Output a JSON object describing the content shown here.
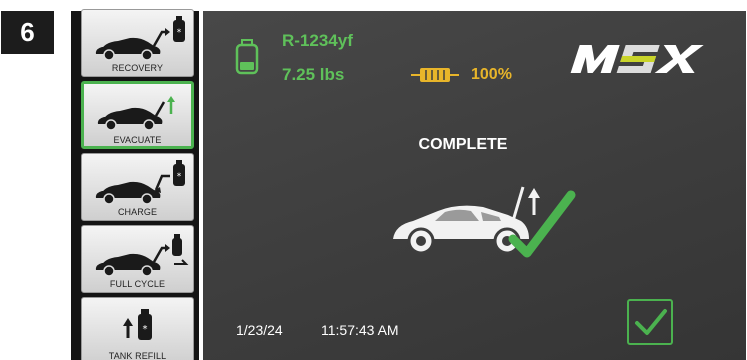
{
  "step": {
    "number": "6"
  },
  "sidebar": {
    "items": [
      {
        "label": "RECOVERY",
        "icon": "car-recovery-icon",
        "active": false
      },
      {
        "label": "EVACUATE",
        "icon": "car-evacuate-icon",
        "active": true
      },
      {
        "label": "CHARGE",
        "icon": "car-charge-icon",
        "active": false
      },
      {
        "label": "FULL CYCLE",
        "icon": "car-full-cycle-icon",
        "active": false
      },
      {
        "label": "TANK REFILL",
        "icon": "tank-refill-icon",
        "active": false
      }
    ]
  },
  "header": {
    "refrigerant": "R-1234yf",
    "weight": "7.25 lbs",
    "battery": "100%",
    "logo_text": "MSX"
  },
  "main": {
    "status": "COMPLETE",
    "hero_icon": "car-complete-icon"
  },
  "footer": {
    "date": "1/23/24",
    "time": "11:57:43 AM",
    "confirm_icon": "checkmark-icon"
  },
  "colors": {
    "accent_green": "#5fc15a",
    "battery_yellow": "#e8b52a",
    "screen_bg": "#424242",
    "active_border": "#4bb24f"
  }
}
